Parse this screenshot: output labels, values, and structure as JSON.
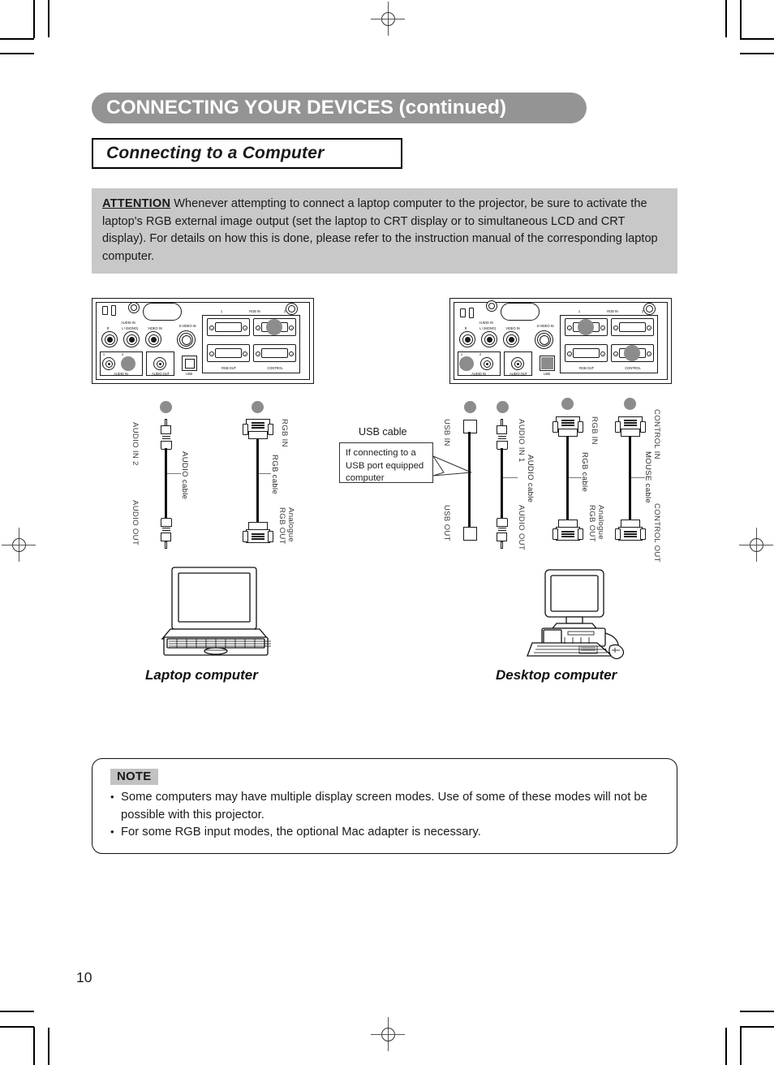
{
  "header": {
    "title": "CONNECTING YOUR DEVICES (continued)",
    "subtitle": "Connecting to a Computer"
  },
  "attention": {
    "label": "ATTENTION",
    "body": "Whenever attempting to connect a laptop computer to the projector, be sure to activate the laptop's RGB external image output (set the laptop to CRT display or to simultaneous LCD and CRT display). For details on how this is done, please refer to the instruction manual of the corresponding laptop computer."
  },
  "panel": {
    "audio_in_group": "AUDIO IN",
    "audio_in_r": "R",
    "audio_in_l": "L / (MONO)",
    "video_in": "VIDEO IN",
    "svideo_in": "S-VIDEO IN",
    "audio_in_bottom": "AUDIO IN",
    "audio_in_1": "1",
    "audio_in_2": "2",
    "audio_out": "AUDIO OUT",
    "usb": "USB",
    "rgb_in": "RGB IN",
    "rgb_in_1": "1",
    "rgb_in_2": "2",
    "rgb_out": "RGB  OUT",
    "control": "CONTROL"
  },
  "laptop": {
    "caption": "Laptop computer",
    "cables": [
      {
        "name": "audio-cable",
        "label": "AUDIO cable",
        "top_label": "AUDIO IN 2",
        "bottom_label": "AUDIO OUT"
      },
      {
        "name": "rgb-cable",
        "label": "RGB cable",
        "top_label": "RGB IN",
        "bottom_label": "Analogue\nRGB OUT",
        "bottom_label_line1": "Analogue",
        "bottom_label_line2": "RGB OUT"
      }
    ]
  },
  "usb_callout": {
    "title": "USB cable",
    "body": "If connecting to a USB port equipped computer"
  },
  "desktop": {
    "caption": "Desktop computer",
    "cables": [
      {
        "name": "usb-cable",
        "label": "",
        "top_label": "USB IN",
        "bottom_label": "USB OUT"
      },
      {
        "name": "audio-cable",
        "label": "AUDIO cable",
        "top_label": "AUDIO IN 1",
        "bottom_label": "AUDIO OUT"
      },
      {
        "name": "rgb-cable",
        "label": "RGB cable",
        "top_label": "RGB IN",
        "bottom_label_line1": "Analogue",
        "bottom_label_line2": "RGB OUT"
      },
      {
        "name": "mouse-cable",
        "label": "MOUSE cable",
        "top_label": "CONTROL IN",
        "bottom_label": "CONTROL OUT"
      }
    ]
  },
  "note": {
    "badge": "NOTE",
    "items": [
      "Some computers may have multiple display screen modes. Use of some of these modes will not be possible with this projector.",
      "For some RGB input modes, the optional Mac adapter is necessary."
    ]
  },
  "page_number": "10"
}
